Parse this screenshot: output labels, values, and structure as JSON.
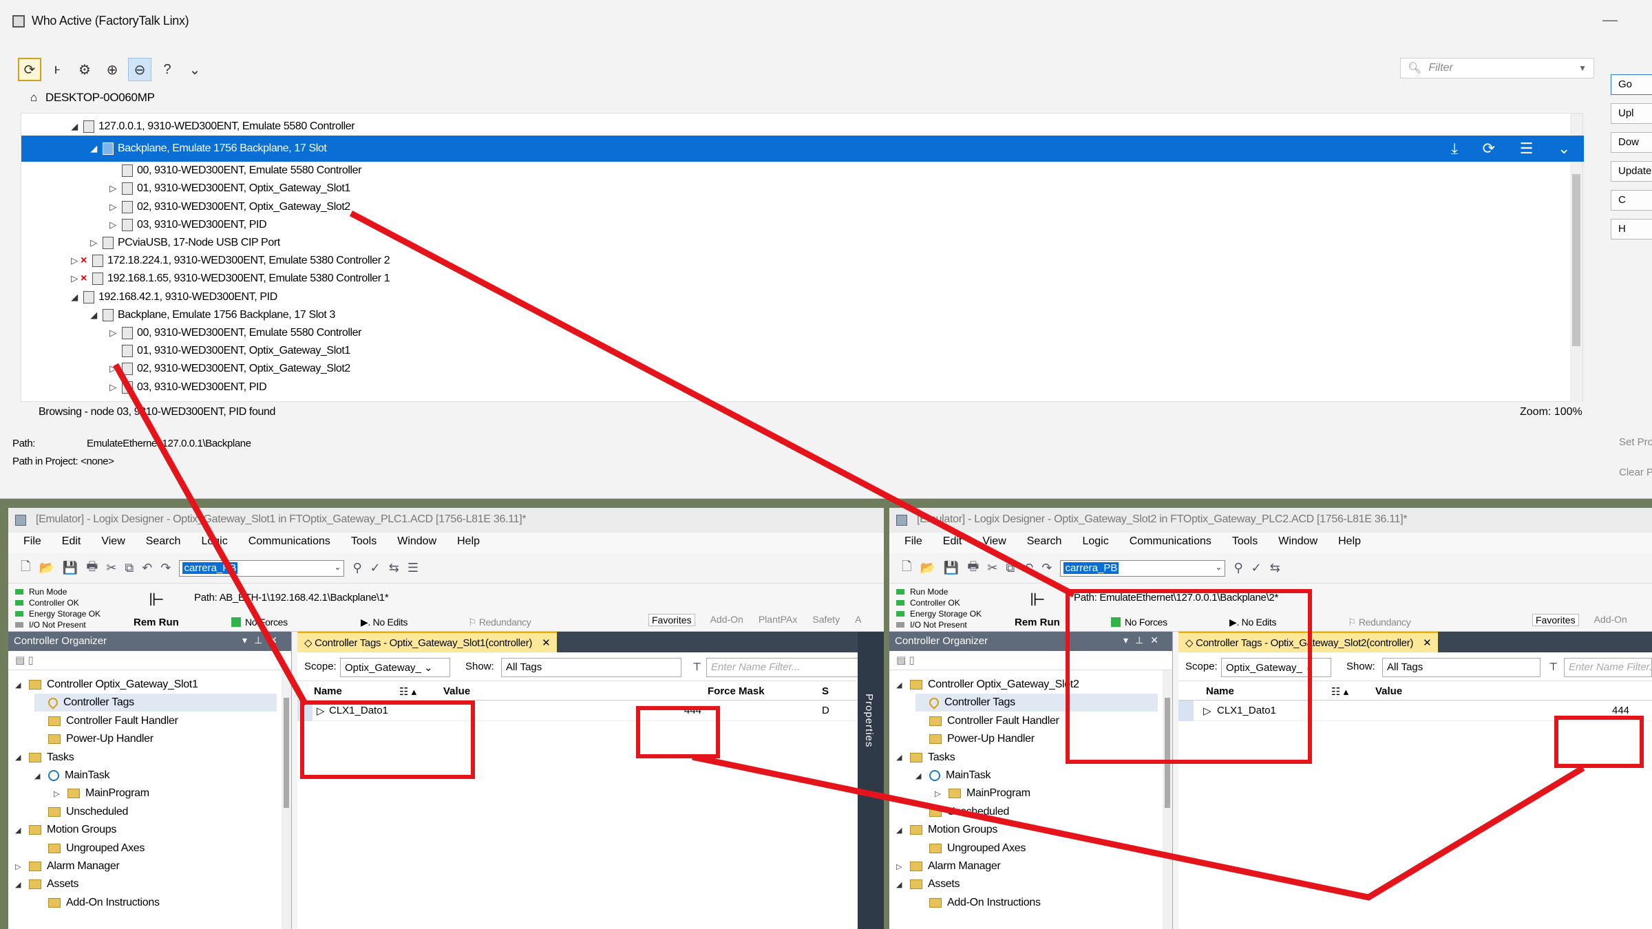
{
  "who_active": {
    "title": "Who Active (FactoryTalk Linx)",
    "filter_placeholder": "Filter",
    "host": "DESKTOP-0O060MP",
    "tree": [
      {
        "text": "127.0.0.1, 9310-WED300ENT, Emulate 5580 Controller",
        "indent": 1,
        "exp": "◢",
        "err": false
      },
      {
        "text": "Backplane, Emulate 1756 Backplane, 17 Slot",
        "indent": 2,
        "exp": "◢",
        "err": false,
        "selected": true
      },
      {
        "text": "00, 9310-WED300ENT, Emulate 5580 Controller",
        "indent": 3,
        "exp": "",
        "err": false
      },
      {
        "text": "01, 9310-WED300ENT, Optix_Gateway_Slot1",
        "indent": 3,
        "exp": "▷",
        "err": false
      },
      {
        "text": "02, 9310-WED300ENT, Optix_Gateway_Slot2",
        "indent": 3,
        "exp": "▷",
        "err": false
      },
      {
        "text": "03, 9310-WED300ENT, PID",
        "indent": 3,
        "exp": "▷",
        "err": false
      },
      {
        "text": "PCviaUSB, 17-Node USB CIP Port",
        "indent": 2,
        "exp": "▷",
        "err": false
      },
      {
        "text": "172.18.224.1, 9310-WED300ENT, Emulate 5380 Controller 2",
        "indent": 1,
        "exp": "▷",
        "err": true
      },
      {
        "text": "192.168.1.65, 9310-WED300ENT, Emulate 5380 Controller 1",
        "indent": 1,
        "exp": "▷",
        "err": true
      },
      {
        "text": "192.168.42.1, 9310-WED300ENT, PID",
        "indent": 1,
        "exp": "◢",
        "err": false
      },
      {
        "text": "Backplane, Emulate 1756 Backplane, 17 Slot 3",
        "indent": 2,
        "exp": "◢",
        "err": false
      },
      {
        "text": "00, 9310-WED300ENT, Emulate 5580 Controller",
        "indent": 3,
        "exp": "▷",
        "err": false
      },
      {
        "text": "01, 9310-WED300ENT, Optix_Gateway_Slot1",
        "indent": 3,
        "exp": "",
        "err": false
      },
      {
        "text": "02, 9310-WED300ENT, Optix_Gateway_Slot2",
        "indent": 3,
        "exp": "▷",
        "err": false
      },
      {
        "text": "03, 9310-WED300ENT, PID",
        "indent": 3,
        "exp": "▷",
        "err": false
      }
    ],
    "status": "Browsing - node 03, 9310-WED300ENT, PID found",
    "zoom": "Zoom: 100%",
    "path_label": "Path:",
    "path_value": "EmulateEthernet\\127.0.0.1\\Backplane",
    "path_project": "Path in Project: <none>",
    "side_buttons": [
      "Go",
      "Upl",
      "Dow",
      "Update F",
      "C",
      "H"
    ],
    "side_links": [
      "Set Pro",
      "Clear Pr"
    ]
  },
  "logix1": {
    "title": "[Emulator] - Logix Designer - Optix_Gateway_Slot1 in FTOptix_Gateway_PLC1.ACD [1756-L81E 36.11]*",
    "menu": [
      "File",
      "Edit",
      "View",
      "Search",
      "Logic",
      "Communications",
      "Tools",
      "Window",
      "Help"
    ],
    "combo": "carrera_PB",
    "states": [
      "Run Mode",
      "Controller OK",
      "Energy Storage OK",
      "I/O Not Present"
    ],
    "rem_run": "Rem Run",
    "path": "Path: AB_ETH-1\\192.168.42.1\\Backplane\\1*",
    "no_forces": "No Forces",
    "no_edits": "No Edits",
    "redundancy": "Redundancy",
    "ribbon_tabs": [
      "Favorites",
      "Add-On",
      "PlantPAx",
      "Safety",
      "A"
    ],
    "organizer_title": "Controller Organizer",
    "organizer": [
      {
        "text": "Controller Optix_Gateway_Slot1",
        "lvl": 0,
        "ex": "◢",
        "ic": "fd"
      },
      {
        "text": "Controller Tags",
        "lvl": 1,
        "ex": "",
        "ic": "tg",
        "hl": true
      },
      {
        "text": "Controller Fault Handler",
        "lvl": 1,
        "ex": "",
        "ic": "fd"
      },
      {
        "text": "Power-Up Handler",
        "lvl": 1,
        "ex": "",
        "ic": "fd"
      },
      {
        "text": "Tasks",
        "lvl": 0,
        "ex": "◢",
        "ic": "fd"
      },
      {
        "text": "MainTask",
        "lvl": 1,
        "ex": "◢",
        "ic": "cy"
      },
      {
        "text": "MainProgram",
        "lvl": 2,
        "ex": "▷",
        "ic": "fd"
      },
      {
        "text": "Unscheduled",
        "lvl": 1,
        "ex": "",
        "ic": "fd"
      },
      {
        "text": "Motion Groups",
        "lvl": 0,
        "ex": "◢",
        "ic": "fd"
      },
      {
        "text": "Ungrouped Axes",
        "lvl": 1,
        "ex": "",
        "ic": "fd"
      },
      {
        "text": "Alarm Manager",
        "lvl": 0,
        "ex": "▷",
        "ic": "fd"
      },
      {
        "text": "Assets",
        "lvl": 0,
        "ex": "◢",
        "ic": "fd"
      },
      {
        "text": "Add-On Instructions",
        "lvl": 1,
        "ex": "",
        "ic": "fd"
      }
    ],
    "tags_tab": "Controller Tags - Optix_Gateway_Slot1(controller)",
    "scope_label": "Scope:",
    "scope_value": "Optix_Gateway_",
    "show_label": "Show:",
    "show_value": "All Tags",
    "name_filter": "Enter Name Filter...",
    "col_name": "Name",
    "col_value": "Value",
    "col_force": "Force Mask",
    "col_s": "S",
    "tag_name": "CLX1_Dato1",
    "tag_value": "444",
    "tag_style": "D",
    "properties": "Properties"
  },
  "logix2": {
    "title": "[Emulator] - Logix Designer - Optix_Gateway_Slot2 in FTOptix_Gateway_PLC2.ACD [1756-L81E 36.11]*",
    "menu": [
      "File",
      "Edit",
      "View",
      "Search",
      "Logic",
      "Communications",
      "Tools",
      "Window",
      "Help"
    ],
    "combo": "carrera_PB",
    "states": [
      "Run Mode",
      "Controller OK",
      "Energy Storage OK",
      "I/O Not Present"
    ],
    "rem_run": "Rem Run",
    "path": "Path: EmulateEthernet\\127.0.0.1\\Backplane\\2*",
    "no_forces": "No Forces",
    "no_edits": "No Edits",
    "redundancy": "Redundancy",
    "ribbon_tabs": [
      "Favorites",
      "Add-On"
    ],
    "organizer_title": "Controller Organizer",
    "organizer": [
      {
        "text": "Controller Optix_Gateway_Slot2",
        "lvl": 0,
        "ex": "◢",
        "ic": "fd"
      },
      {
        "text": "Controller Tags",
        "lvl": 1,
        "ex": "",
        "ic": "tg",
        "hl": true
      },
      {
        "text": "Controller Fault Handler",
        "lvl": 1,
        "ex": "",
        "ic": "fd"
      },
      {
        "text": "Power-Up Handler",
        "lvl": 1,
        "ex": "",
        "ic": "fd"
      },
      {
        "text": "Tasks",
        "lvl": 0,
        "ex": "◢",
        "ic": "fd"
      },
      {
        "text": "MainTask",
        "lvl": 1,
        "ex": "◢",
        "ic": "cy"
      },
      {
        "text": "MainProgram",
        "lvl": 2,
        "ex": "▷",
        "ic": "fd"
      },
      {
        "text": "Unscheduled",
        "lvl": 1,
        "ex": "",
        "ic": "fd"
      },
      {
        "text": "Motion Groups",
        "lvl": 0,
        "ex": "◢",
        "ic": "fd"
      },
      {
        "text": "Ungrouped Axes",
        "lvl": 1,
        "ex": "",
        "ic": "fd"
      },
      {
        "text": "Alarm Manager",
        "lvl": 0,
        "ex": "▷",
        "ic": "fd"
      },
      {
        "text": "Assets",
        "lvl": 0,
        "ex": "◢",
        "ic": "fd"
      },
      {
        "text": "Add-On Instructions",
        "lvl": 1,
        "ex": "",
        "ic": "fd"
      }
    ],
    "tags_tab": "Controller Tags - Optix_Gateway_Slot2(controller)",
    "scope_label": "Scope:",
    "scope_value": "Optix_Gateway_",
    "show_label": "Show:",
    "show_value": "All Tags",
    "name_filter": "Enter Name Filter...",
    "col_name": "Name",
    "col_value": "Value",
    "tag_name": "CLX1_Dato1",
    "tag_value": "444"
  },
  "colors": {
    "selection": "#0a6fd4",
    "annotation": "#e5141b",
    "tab_active": "#fde89a"
  }
}
